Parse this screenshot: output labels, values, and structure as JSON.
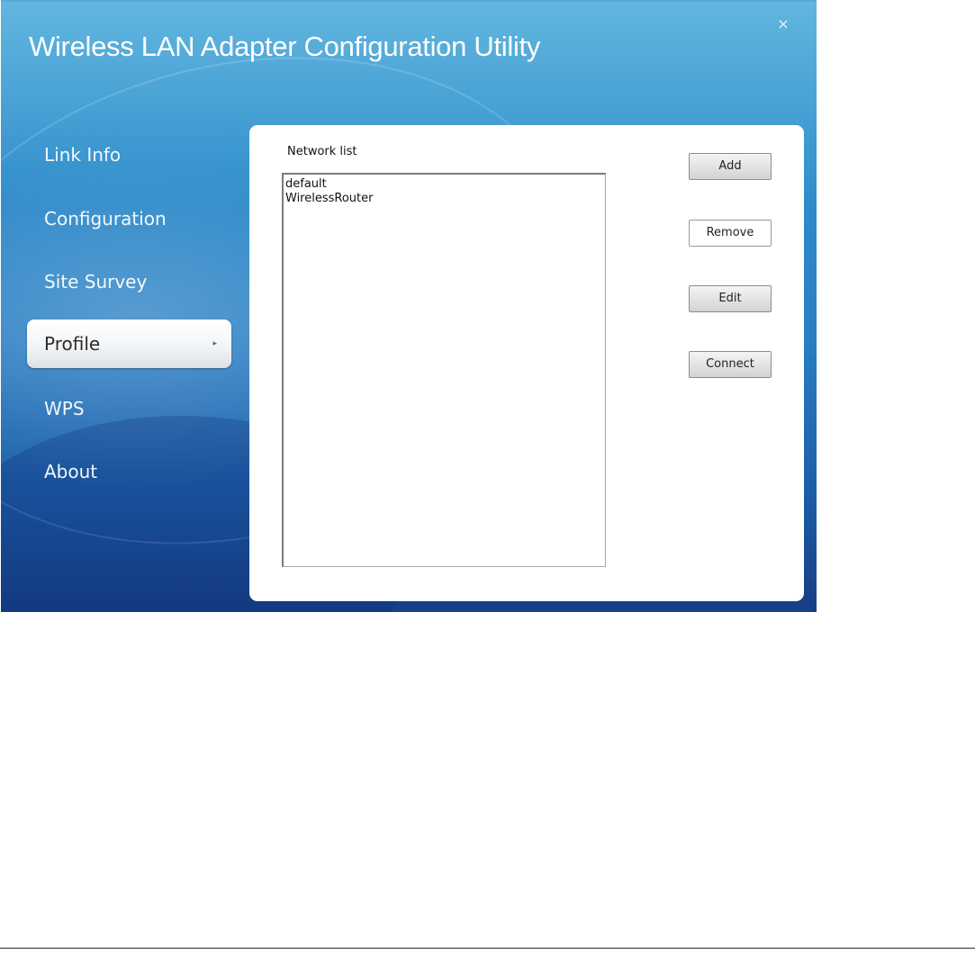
{
  "window": {
    "title": "Wireless LAN Adapter Configuration Utility",
    "close_glyph": "×"
  },
  "sidebar": {
    "items": [
      {
        "label": "Link Info",
        "active": false
      },
      {
        "label": "Configuration",
        "active": false
      },
      {
        "label": "Site Survey",
        "active": false
      },
      {
        "label": "Profile",
        "active": true
      },
      {
        "label": "WPS",
        "active": false
      },
      {
        "label": "About",
        "active": false
      }
    ],
    "active_arrow_glyph": "▸"
  },
  "profile": {
    "list_label": "Network list",
    "networks": [
      "default",
      "WirelessRouter"
    ],
    "buttons": {
      "add": "Add",
      "remove": "Remove",
      "edit": "Edit",
      "connect": "Connect"
    }
  },
  "colors": {
    "window_top": "#62b6de",
    "window_bottom": "#163f86",
    "panel_bg": "#ffffff",
    "nav_text": "#f2f8fc"
  }
}
